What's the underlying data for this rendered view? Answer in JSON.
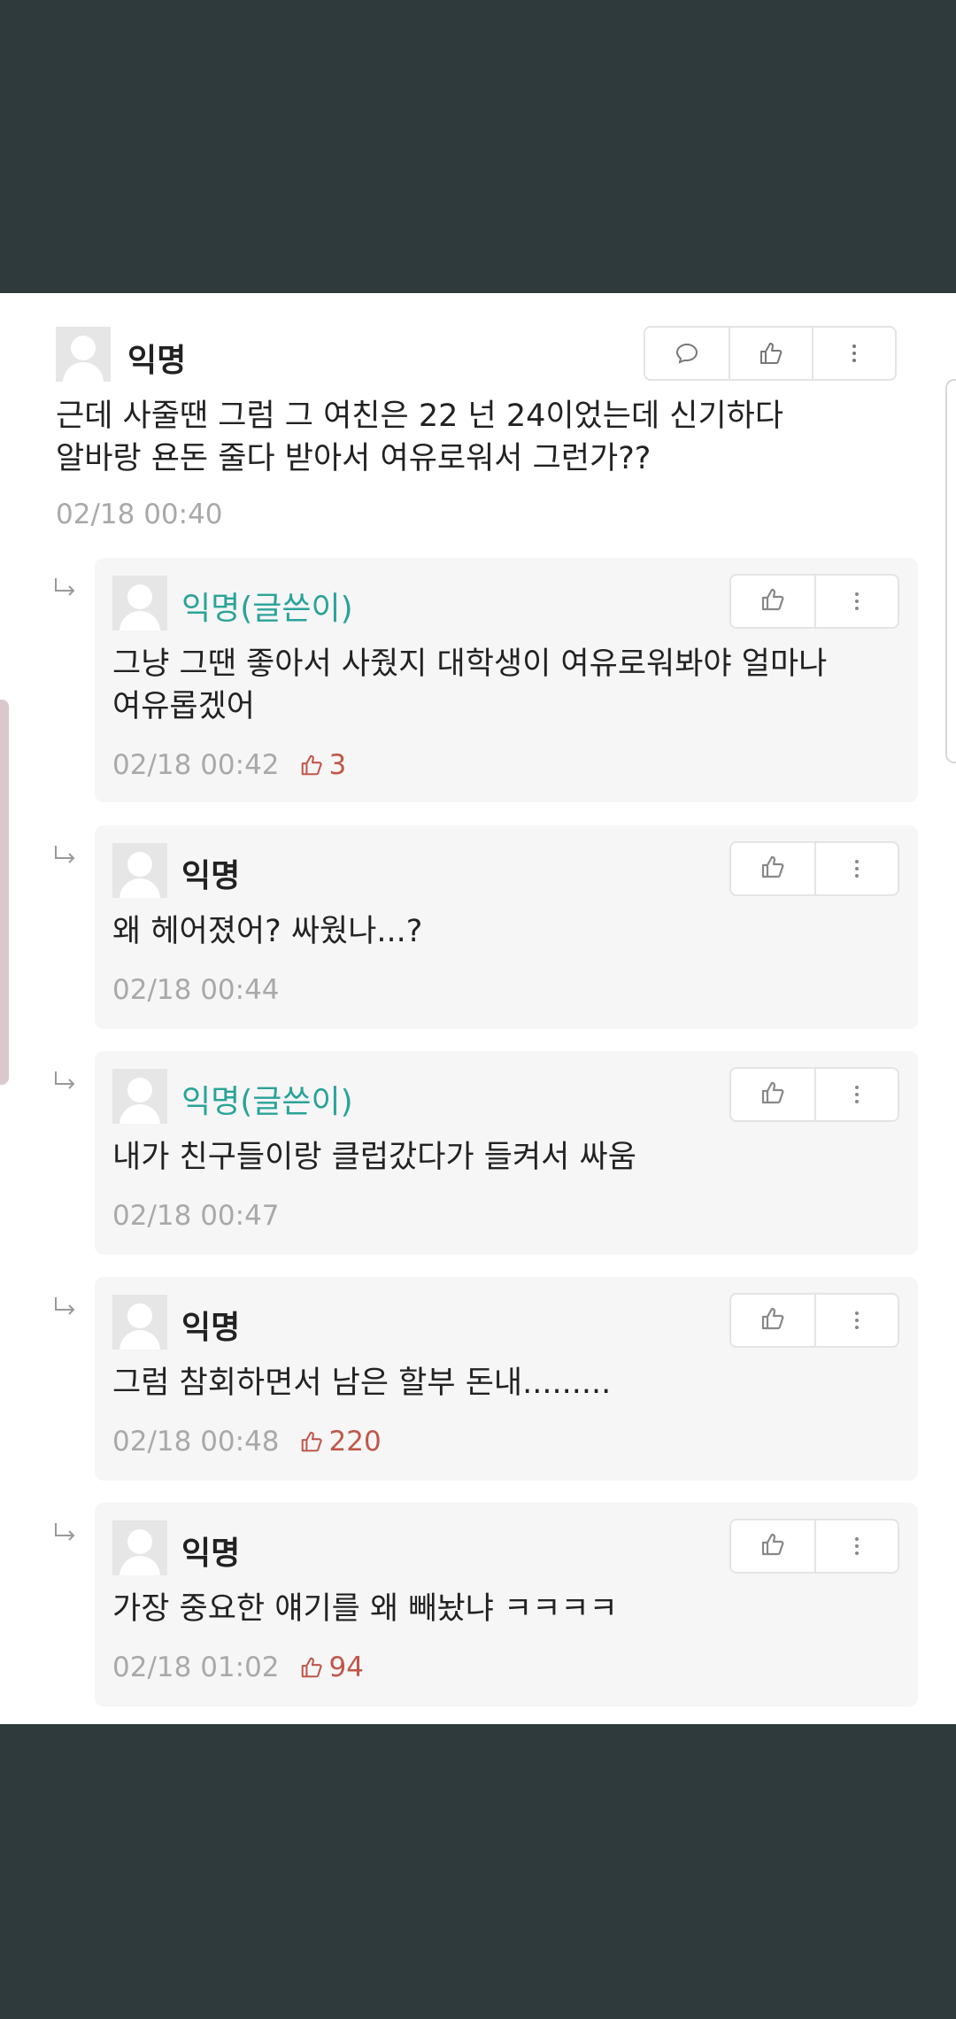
{
  "main": {
    "name": "익명",
    "lines": [
      "근데 사줄땐 그럼 그 여친은 22 넌 24이었는데 신기하다",
      "알바랑 욘돈 줄다 받아서 여유로워서 그런가??"
    ],
    "time": "02/18 00:40"
  },
  "replies": [
    {
      "name": "익명(글쓴이)",
      "lines": [
        "그냥 그땐 좋아서 사줬지 대학생이 여유로워봐야 얼마나",
        "여유롭겠어"
      ],
      "time": "02/18 00:42",
      "likes": "3"
    },
    {
      "name": "익명",
      "lines": [
        "왜 헤어졌어? 싸웠나...?"
      ],
      "time": "02/18 00:44",
      "likes": ""
    },
    {
      "name": "익명(글쓴이)",
      "lines": [
        "내가 친구들이랑 클럽갔다가 들켜서 싸움"
      ],
      "time": "02/18 00:47",
      "likes": ""
    },
    {
      "name": "익명",
      "lines": [
        "그럼 참회하면서 남은 할부 돈내........."
      ],
      "time": "02/18 00:48",
      "likes": "220"
    },
    {
      "name": "익명",
      "lines": [
        "가장 중요한 얘기를 왜 빼놨냐 ㅋㅋㅋㅋ"
      ],
      "time": "02/18 01:02",
      "likes": "94"
    }
  ],
  "colors": {
    "author_name": "#2aa39a",
    "like_count": "#c0574a",
    "background_dark": "#2e3a3b"
  },
  "icons": [
    "comment-icon",
    "thumbs-up-icon",
    "more-vertical-icon",
    "reply-arrow-icon",
    "avatar-placeholder-icon"
  ]
}
